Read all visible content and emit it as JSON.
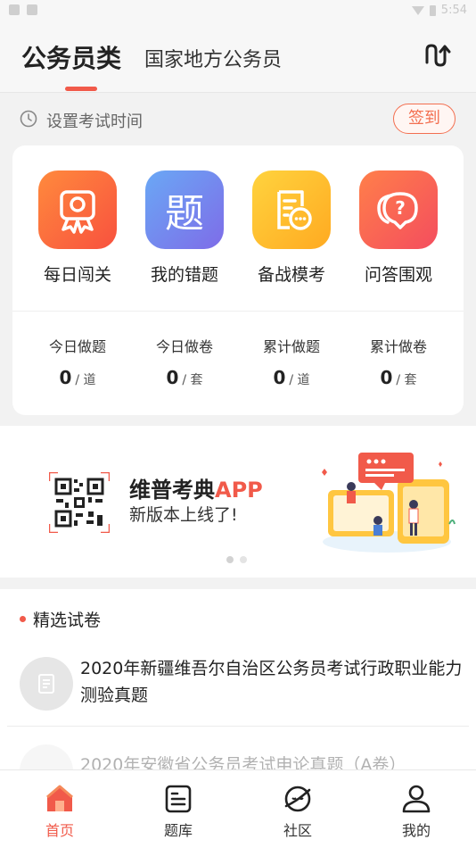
{
  "statusbar": {
    "time": "5:54"
  },
  "header": {
    "title": "公务员类",
    "subtitle": "国家地方公务员",
    "switch_icon": "switch-icon"
  },
  "timebar": {
    "label": "设置考试时间",
    "signin_label": "签到"
  },
  "features": [
    {
      "label": "每日闯关",
      "icon": "medal-icon",
      "text": "",
      "color_from": "#ff8a3d",
      "color_to": "#f8513e"
    },
    {
      "label": "我的错题",
      "icon": "ti-character-icon",
      "text": "题",
      "color_from": "#6aa8f5",
      "color_to": "#7e6ce8"
    },
    {
      "label": "备战模考",
      "icon": "exam-paper-icon",
      "text": "",
      "color_from": "#ffd33e",
      "color_to": "#ffaa21"
    },
    {
      "label": "问答围观",
      "icon": "question-bubble-icon",
      "text": "?",
      "color_from": "#ff7f4a",
      "color_to": "#f44d5e"
    }
  ],
  "stats": [
    {
      "label": "今日做题",
      "value": "0",
      "unit": "/ 道"
    },
    {
      "label": "今日做卷",
      "value": "0",
      "unit": "/ 套"
    },
    {
      "label": "累计做题",
      "value": "0",
      "unit": "/ 道"
    },
    {
      "label": "累计做卷",
      "value": "0",
      "unit": "/ 套"
    }
  ],
  "banner": {
    "title_main": "维普考典",
    "title_accent": "APP",
    "subtitle": "新版本上线了!",
    "active_dot": 1,
    "dot_count": 2
  },
  "section": {
    "title": "精选试卷",
    "items": [
      {
        "title": "2020年新疆维吾尔自治区公务员考试行政职业能力测验真题"
      },
      {
        "title": "2020年安徽省公务员考试申论真题（A卷）"
      }
    ]
  },
  "tabs": [
    {
      "label": "首页",
      "icon": "home-icon",
      "active": true
    },
    {
      "label": "题库",
      "icon": "question-bank-icon",
      "active": false
    },
    {
      "label": "社区",
      "icon": "community-planet-icon",
      "active": false
    },
    {
      "label": "我的",
      "icon": "profile-icon",
      "active": false
    }
  ],
  "colors": {
    "accent": "#f15a4a",
    "signin": "#f36f50"
  }
}
